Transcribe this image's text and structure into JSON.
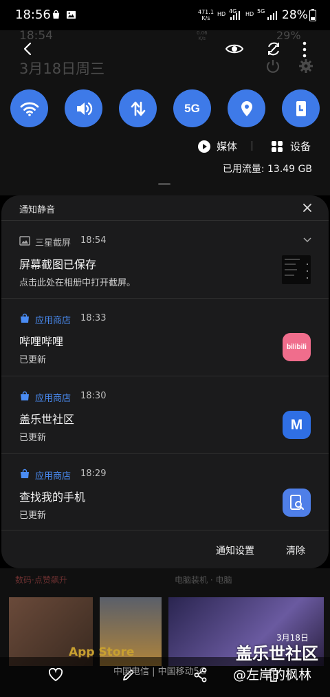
{
  "status_bar": {
    "time": "18:56",
    "net_speed_value": "471.1",
    "net_speed_unit": "K/s",
    "battery_pct": "28%",
    "network_labels": [
      "HD",
      "4G",
      "HD",
      "5G"
    ]
  },
  "ghost_header": {
    "time": "18:54",
    "date": "3月18日周三",
    "net_speed_value": "0.06",
    "net_speed_unit": "K/s",
    "battery_pct": "29%"
  },
  "top_bar": {
    "icons": [
      "back-icon",
      "eye-icon",
      "rotate-icon",
      "more-icon"
    ]
  },
  "quick_settings": [
    {
      "name": "wifi",
      "icon": "wifi-icon"
    },
    {
      "name": "sound",
      "icon": "sound-icon"
    },
    {
      "name": "mobile-data",
      "icon": "data-arrows-icon"
    },
    {
      "name": "5g",
      "icon": "5g-icon",
      "label": "5G"
    },
    {
      "name": "location",
      "icon": "location-pin-icon"
    },
    {
      "name": "orientation",
      "icon": "portrait-lock-icon"
    }
  ],
  "media_row": {
    "media_label": "媒体",
    "device_label": "设备"
  },
  "data_usage": "已用流量: 13.49 GB",
  "notif_card": {
    "title": "通知静音",
    "footer": {
      "settings_label": "通知设置",
      "clear_label": "清除"
    }
  },
  "notifications": [
    {
      "app": "三星截屏",
      "time": "18:54",
      "title": "屏幕截图已保存",
      "text": "点击此处在相册中打开截屏。",
      "app_icon": "image-icon"
    },
    {
      "app": "应用商店",
      "time": "18:33",
      "title": "哔哩哔哩",
      "text": "已更新",
      "app_icon": "store-bag-icon",
      "thumb_label": "bilibili"
    },
    {
      "app": "应用商店",
      "time": "18:30",
      "title": "盖乐世社区",
      "text": "已更新",
      "app_icon": "store-bag-icon",
      "thumb_label": "M"
    },
    {
      "app": "应用商店",
      "time": "18:29",
      "title": "查找我的手机",
      "text": "已更新",
      "app_icon": "store-bag-icon"
    }
  ],
  "background_app": {
    "left_label": "数码·点赞飙升",
    "right_label": "电脑装机 · 电脑",
    "banner_text": "App Store",
    "carrier_text": "中国电信 | 中国移动5G",
    "date_badge": "3月18日"
  },
  "watermark": {
    "line1": "盖乐世社区",
    "line2": "@左岸的枫林"
  },
  "colors": {
    "accent": "#3e7ae8",
    "app_blue": "#4a8cf4",
    "card_bg": "#1b1b1c",
    "panel_bg": "#121212",
    "bili_pink": "#f06d8c"
  }
}
